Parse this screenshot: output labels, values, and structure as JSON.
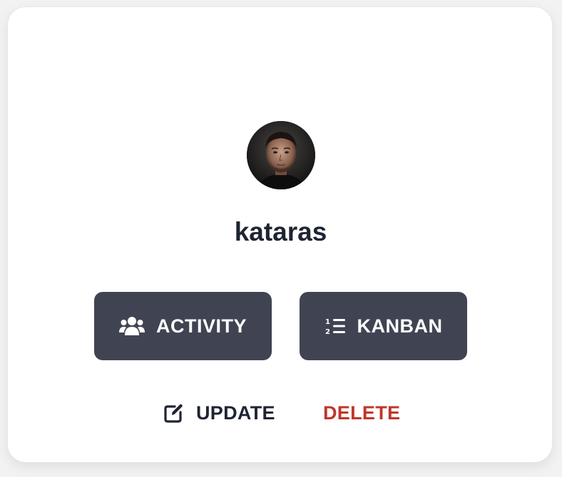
{
  "profile": {
    "username": "kataras",
    "avatar_icon": "user-photo"
  },
  "actions": {
    "activity_label": "ACTIVITY",
    "activity_icon": "users-icon",
    "kanban_label": "KANBAN",
    "kanban_icon": "numbered-list-icon",
    "update_label": "UPDATE",
    "update_icon": "edit-icon",
    "delete_label": "DELETE"
  },
  "colors": {
    "button_bg": "#404452",
    "text_dark": "#1f2433",
    "danger": "#c0352b"
  }
}
